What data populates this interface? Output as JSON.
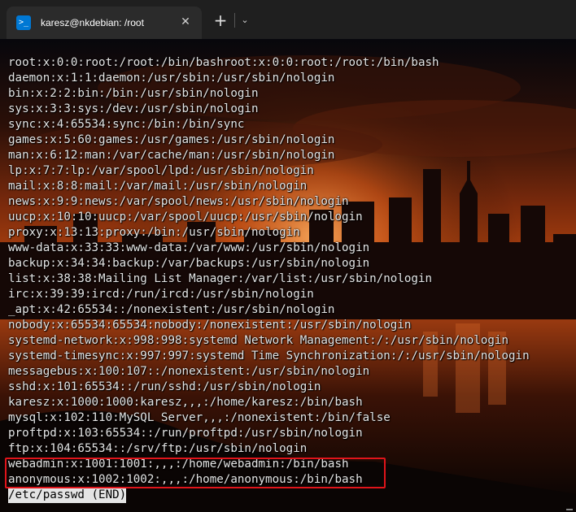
{
  "tab": {
    "icon": ">_",
    "title": "karesz@nkdebian: /root",
    "close": "✕"
  },
  "new_tab_label": "+",
  "dropdown_label": "⌄",
  "terminal": {
    "lines": [
      "root:x:0:0:root:/root:/bin/bashroot:x:0:0:root:/root:/bin/bash",
      "daemon:x:1:1:daemon:/usr/sbin:/usr/sbin/nologin",
      "bin:x:2:2:bin:/bin:/usr/sbin/nologin",
      "sys:x:3:3:sys:/dev:/usr/sbin/nologin",
      "sync:x:4:65534:sync:/bin:/bin/sync",
      "games:x:5:60:games:/usr/games:/usr/sbin/nologin",
      "man:x:6:12:man:/var/cache/man:/usr/sbin/nologin",
      "lp:x:7:7:lp:/var/spool/lpd:/usr/sbin/nologin",
      "mail:x:8:8:mail:/var/mail:/usr/sbin/nologin",
      "news:x:9:9:news:/var/spool/news:/usr/sbin/nologin",
      "uucp:x:10:10:uucp:/var/spool/uucp:/usr/sbin/nologin",
      "proxy:x:13:13:proxy:/bin:/usr/sbin/nologin",
      "www-data:x:33:33:www-data:/var/www:/usr/sbin/nologin",
      "backup:x:34:34:backup:/var/backups:/usr/sbin/nologin",
      "list:x:38:38:Mailing List Manager:/var/list:/usr/sbin/nologin",
      "irc:x:39:39:ircd:/run/ircd:/usr/sbin/nologin",
      "_apt:x:42:65534::/nonexistent:/usr/sbin/nologin",
      "nobody:x:65534:65534:nobody:/nonexistent:/usr/sbin/nologin",
      "systemd-network:x:998:998:systemd Network Management:/:/usr/sbin/nologin",
      "systemd-timesync:x:997:997:systemd Time Synchronization:/:/usr/sbin/nologin",
      "messagebus:x:100:107::/nonexistent:/usr/sbin/nologin",
      "sshd:x:101:65534::/run/sshd:/usr/sbin/nologin",
      "karesz:x:1000:1000:karesz,,,:/home/karesz:/bin/bash",
      "mysql:x:102:110:MySQL Server,,,:/nonexistent:/bin/false",
      "proftpd:x:103:65534::/run/proftpd:/usr/sbin/nologin",
      "ftp:x:104:65534::/srv/ftp:/usr/sbin/nologin",
      "webadmin:x:1001:1001:,,,:/home/webadmin:/bin/bash",
      "anonymous:x:1002:1002:,,,:/home/anonymous:/bin/bash"
    ],
    "status_line": "/etc/passwd (END)"
  },
  "colors": {
    "accent": "#0078d4",
    "highlight_border": "#e0141a",
    "text": "#e4e4e4"
  }
}
